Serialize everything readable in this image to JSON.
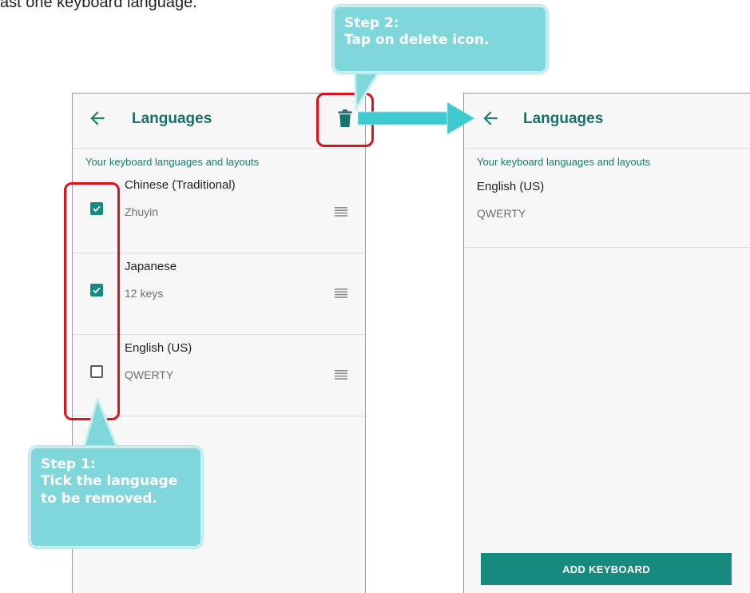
{
  "caption": "ast one keyboard language.",
  "left_screen": {
    "title": "Languages",
    "section_header": "Your keyboard languages and layouts",
    "items": [
      {
        "name": "Chinese (Traditional)",
        "layout": "Zhuyin",
        "checked": true
      },
      {
        "name": "Japanese",
        "layout": "12 keys",
        "checked": true
      },
      {
        "name": "English (US)",
        "layout": "QWERTY",
        "checked": false
      }
    ]
  },
  "right_screen": {
    "title": "Languages",
    "section_header": "Your keyboard languages and layouts",
    "items": [
      {
        "name": "English (US)",
        "layout": "QWERTY"
      }
    ],
    "add_button_label": "ADD KEYBOARD"
  },
  "callouts": {
    "step1": {
      "line1": "Step 1:",
      "line2": "Tick the language",
      "line3": "to be removed."
    },
    "step2": {
      "line1": "Step 2:",
      "line2": "Tap on delete icon."
    }
  },
  "colors": {
    "accent": "#168a7e",
    "title": "#1b6f66",
    "highlight": "#e1101e",
    "callout": "#7fd7dc",
    "arrow": "#3ec9cf"
  },
  "icons": [
    "back-arrow-icon",
    "trash-icon",
    "drag-handle-icon",
    "checkmark-icon"
  ]
}
